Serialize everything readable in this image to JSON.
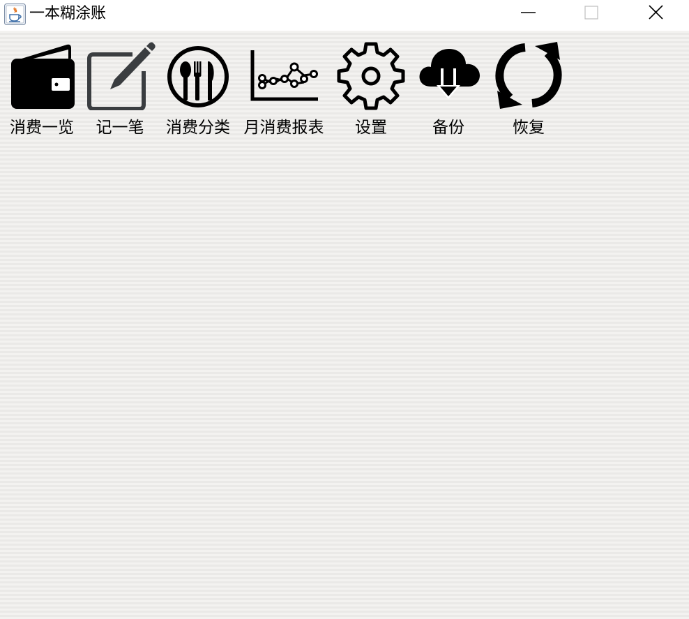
{
  "window": {
    "title": "一本糊涂账",
    "controls": {
      "minimize": "minimize-icon",
      "maximize": "maximize-icon",
      "close": "close-icon"
    }
  },
  "toolbar": {
    "items": [
      {
        "label": "消费一览",
        "icon": "wallet-icon"
      },
      {
        "label": "记一笔",
        "icon": "edit-icon"
      },
      {
        "label": "消费分类",
        "icon": "utensils-icon"
      },
      {
        "label": "月消费报表",
        "icon": "line-chart-icon"
      },
      {
        "label": "设置",
        "icon": "gear-icon"
      },
      {
        "label": "备份",
        "icon": "cloud-download-icon"
      },
      {
        "label": "恢复",
        "icon": "refresh-icon"
      }
    ]
  },
  "colors": {
    "icon": "#000000",
    "edit_icon": "#3a3d40",
    "background": "#f0efed",
    "titlebar": "#ffffff"
  }
}
